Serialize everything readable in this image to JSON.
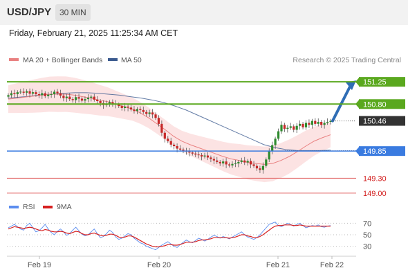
{
  "header": {
    "pair": "USD/JPY",
    "timeframe": "30 MIN"
  },
  "datetime": "Friday, February 21, 2025 11:25:34 AM CET",
  "legend": {
    "ma20_bb": "MA 20 + Bollinger Bands",
    "ma50": "MA 50",
    "source": "Research © 2025 Trading Central"
  },
  "colors": {
    "bollinger_fill": "#fbdede",
    "ma20": "#e98080",
    "ma50": "#3b5a8f",
    "candle_up": "#2e8b2e",
    "candle_down": "#c62828",
    "resistance": "#5aa81e",
    "support": "#3a7be0",
    "limit": "#e06060",
    "current": "#333333",
    "arrow": "#2f6db5",
    "rsi": "#5b8def",
    "rsi_ma": "#d62020"
  },
  "chart_data": [
    {
      "type": "line",
      "title": "USD/JPY 30 MIN",
      "x_tick_labels": [
        "Feb 19",
        "Feb 20",
        "Feb 21",
        "Feb 22"
      ],
      "ylim": [
        148.9,
        151.7
      ],
      "series": [
        {
          "name": "MA 20 + Bollinger Bands"
        },
        {
          "name": "MA 50"
        }
      ],
      "candles_close": [
        150.98,
        151.02,
        151.0,
        151.04,
        151.05,
        151.03,
        151.06,
        151.01,
        151.04,
        151.0,
        150.98,
        151.02,
        150.96,
        150.99,
        151.0,
        151.05,
        151.02,
        150.97,
        150.92,
        150.95,
        150.9,
        150.88,
        150.94,
        150.91,
        150.87,
        150.9,
        150.93,
        150.95,
        150.89,
        150.86,
        150.82,
        150.78,
        150.8,
        150.84,
        150.81,
        150.79,
        150.76,
        150.72,
        150.75,
        150.73,
        150.69,
        150.66,
        150.7,
        150.68,
        150.64,
        150.6,
        150.63,
        150.59,
        150.52,
        150.4,
        150.22,
        150.1,
        150.05,
        149.98,
        149.95,
        149.9,
        149.88,
        149.86,
        149.84,
        149.82,
        149.8,
        149.78,
        149.77,
        149.74,
        149.76,
        149.72,
        149.69,
        149.66,
        149.63,
        149.6,
        149.64,
        149.58,
        149.56,
        149.59,
        149.6,
        149.63,
        149.66,
        149.62,
        149.65,
        149.58,
        149.55,
        149.5,
        149.47,
        149.55,
        149.68,
        149.85,
        149.97,
        150.1,
        150.25,
        150.38,
        150.3,
        150.32,
        150.35,
        150.28,
        150.36,
        150.4,
        150.33,
        150.42,
        150.38,
        150.46,
        150.4,
        150.44,
        150.38,
        150.42,
        150.44,
        150.46
      ],
      "ma20": [
        150.9,
        150.92,
        150.94,
        150.96,
        150.98,
        151.0,
        151.0,
        151.0,
        150.98,
        150.95,
        150.92,
        150.88,
        150.85,
        150.8,
        150.75,
        150.7,
        150.62,
        150.52,
        150.4,
        150.28,
        150.15,
        150.05,
        149.98,
        149.92,
        149.86,
        149.8,
        149.74,
        149.69,
        149.66,
        149.62,
        149.6,
        149.58,
        149.6,
        149.66,
        149.74,
        149.84,
        149.95,
        150.05,
        150.12,
        150.18
      ],
      "ma50": [
        150.92,
        150.94,
        150.96,
        150.99,
        151.0,
        151.02,
        151.03,
        151.03,
        151.02,
        151.0,
        150.98,
        150.95,
        150.92,
        150.88,
        150.83,
        150.76,
        150.68,
        150.58,
        150.48,
        150.38,
        150.28,
        150.18,
        150.08,
        149.98,
        149.92,
        149.88,
        149.86,
        149.86,
        149.86,
        149.87
      ],
      "levels": [
        {
          "label": "151.25",
          "value": 151.25,
          "kind": "resistance"
        },
        {
          "label": "150.80",
          "value": 150.8,
          "kind": "resistance"
        },
        {
          "label": "150.46",
          "value": 150.46,
          "kind": "current"
        },
        {
          "label": "149.85",
          "value": 149.85,
          "kind": "support"
        },
        {
          "label": "149.30",
          "value": 149.3,
          "kind": "limit"
        },
        {
          "label": "149.00",
          "value": 149.0,
          "kind": "limit"
        }
      ]
    },
    {
      "type": "line",
      "title": "RSI",
      "series": [
        {
          "name": "RSI",
          "values": [
            62,
            65,
            68,
            64,
            60,
            58,
            66,
            70,
            62,
            55,
            57,
            62,
            68,
            60,
            54,
            50,
            56,
            60,
            55,
            49,
            52,
            58,
            63,
            57,
            51,
            48,
            50,
            55,
            60,
            52,
            45,
            47,
            52,
            58,
            54,
            46,
            42,
            44,
            48,
            52,
            50,
            44,
            40,
            36,
            34,
            30,
            28,
            26,
            24,
            28,
            32,
            35,
            38,
            34,
            30,
            28,
            33,
            37,
            41,
            38,
            36,
            40,
            44,
            42,
            39,
            42,
            46,
            49,
            47,
            44,
            47,
            45,
            43,
            46,
            49,
            52,
            55,
            50,
            46,
            44,
            42,
            45,
            50,
            56,
            62,
            68,
            70,
            72,
            66,
            64,
            67,
            70,
            68,
            65,
            68,
            70,
            66,
            62,
            64,
            66,
            65,
            67,
            64,
            63,
            65,
            66
          ]
        },
        {
          "name": "9MA",
          "values": [
            60,
            62,
            64,
            63,
            62,
            61,
            62,
            63,
            62,
            60,
            58,
            57,
            59,
            58,
            56,
            55,
            55,
            56,
            55,
            53,
            52,
            54,
            56,
            55,
            52,
            50,
            50,
            52,
            53,
            51,
            49,
            48,
            49,
            51,
            51,
            49,
            46,
            45,
            46,
            48,
            48,
            46,
            43,
            40,
            37,
            34,
            32,
            30,
            29,
            29,
            30,
            31,
            33,
            33,
            32,
            32,
            33,
            35,
            37,
            37,
            37,
            38,
            40,
            41,
            41,
            42,
            43,
            45,
            45,
            45,
            45,
            45,
            44,
            45,
            46,
            48,
            50,
            50,
            48,
            47,
            45,
            45,
            47,
            50,
            54,
            58,
            62,
            65,
            66,
            66,
            67,
            67,
            67,
            66,
            66,
            67,
            66,
            65,
            65,
            65,
            65,
            65,
            65,
            65,
            65,
            65
          ]
        }
      ],
      "y_ticks": [
        "70",
        "50",
        "30"
      ],
      "ylim": [
        20,
        80
      ]
    }
  ]
}
